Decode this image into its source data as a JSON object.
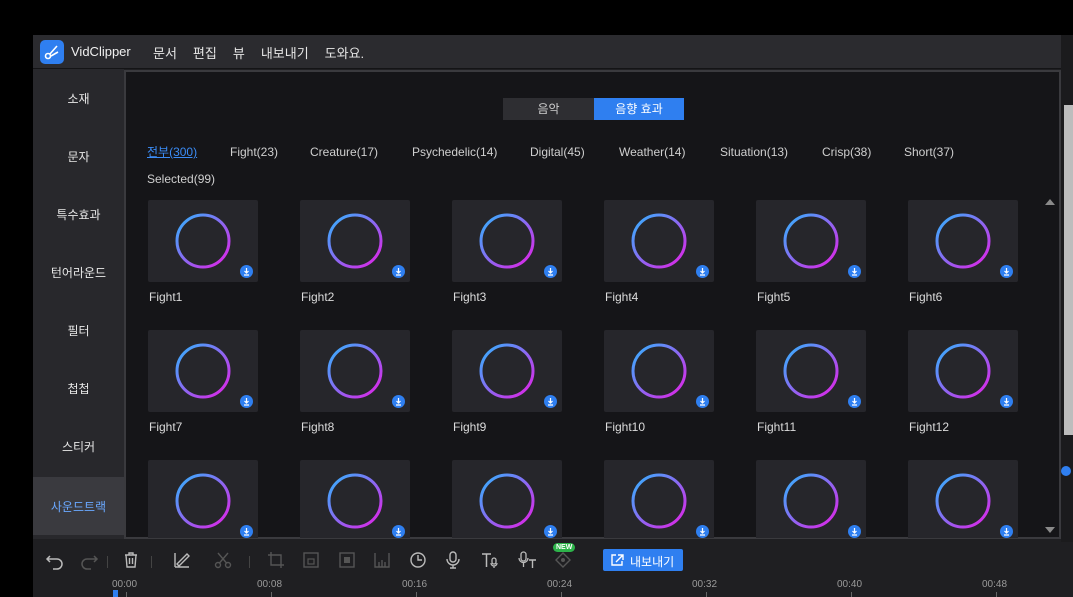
{
  "app": {
    "title": "VidClipper"
  },
  "menu": [
    "문서",
    "편집",
    "뷰",
    "내보내기",
    "도와요."
  ],
  "sidebar": {
    "items": [
      {
        "label": "소재"
      },
      {
        "label": "문자"
      },
      {
        "label": "특수효과"
      },
      {
        "label": "턴어라운드"
      },
      {
        "label": "필터"
      },
      {
        "label": "첩첩"
      },
      {
        "label": "스티커"
      },
      {
        "label": "사운드트랙"
      }
    ],
    "active_index": 7
  },
  "tabs": {
    "music": "음악",
    "sound_effects": "음향 효과",
    "active": "sound_effects"
  },
  "categories": [
    {
      "label": "전부(300)",
      "active": true
    },
    {
      "label": "Fight(23)"
    },
    {
      "label": "Creature(17)"
    },
    {
      "label": "Psychedelic(14)"
    },
    {
      "label": "Digital(45)"
    },
    {
      "label": "Weather(14)"
    },
    {
      "label": "Situation(13)"
    },
    {
      "label": "Crisp(38)"
    },
    {
      "label": "Short(37)"
    },
    {
      "label": "Selected(99)"
    }
  ],
  "items": [
    {
      "label": "Fight1"
    },
    {
      "label": "Fight2"
    },
    {
      "label": "Fight3"
    },
    {
      "label": "Fight4"
    },
    {
      "label": "Fight5"
    },
    {
      "label": "Fight6"
    },
    {
      "label": "Fight7"
    },
    {
      "label": "Fight8"
    },
    {
      "label": "Fight9"
    },
    {
      "label": "Fight10"
    },
    {
      "label": "Fight11"
    },
    {
      "label": "Fight12"
    },
    {
      "label": ""
    },
    {
      "label": ""
    },
    {
      "label": ""
    },
    {
      "label": ""
    },
    {
      "label": ""
    },
    {
      "label": ""
    }
  ],
  "toolbar": {
    "icons": [
      "undo-icon",
      "redo-icon",
      "delete-icon",
      "edit-icon",
      "cut-icon",
      "crop-icon",
      "resize-icon",
      "mosaic-icon",
      "freeze-icon",
      "duration-icon",
      "record-icon",
      "text-to-speech-icon",
      "speech-to-text-icon"
    ],
    "new_badge": "NEW",
    "export_label": "내보내기"
  },
  "timeline": {
    "ticks": [
      "00:00",
      "00:08",
      "00:16",
      "00:24",
      "00:32",
      "00:40",
      "00:48"
    ]
  },
  "colors": {
    "accent": "#2f7ff0",
    "panel_bg": "#151518",
    "card_bg": "#26262b"
  }
}
